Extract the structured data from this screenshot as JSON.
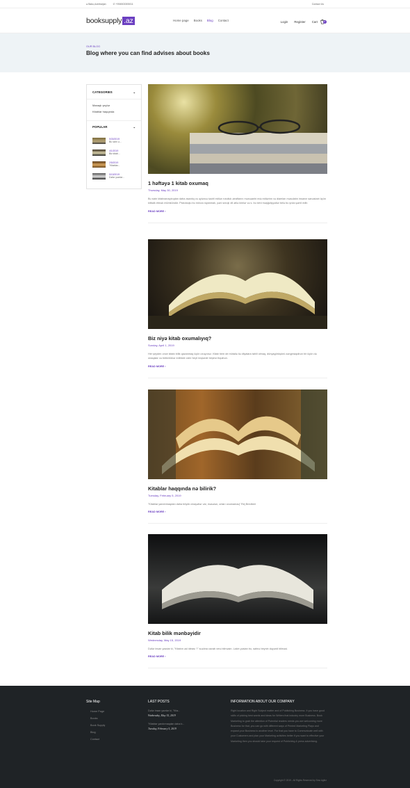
{
  "topbar": {
    "location": "Baku,Azerbaijan",
    "phone": "+994503305011",
    "contact": "Contact Us"
  },
  "nav": {
    "logo_main": "booksupply",
    "logo_suffix": ".az",
    "menu": [
      "Home page",
      "Books",
      "Blog",
      "Contact"
    ],
    "login": "Login",
    "register": "Register",
    "cart": "Cart",
    "cart_count": "0"
  },
  "hero": {
    "kicker": "OUR BLOG",
    "title": "Blog where you can find advises about books"
  },
  "sidebar": {
    "categories_title": "CATEGORIES",
    "categories": [
      "Maraqlı şeylər",
      "Kitablar haqqında"
    ],
    "popular_title": "POPULAR",
    "popular": [
      {
        "date": "5/30/2019",
        "title": "Bu sizin ə..."
      },
      {
        "date": "4/1/2019",
        "title": "Biz kitab..."
      },
      {
        "date": "2/5/2019",
        "title": "\"Kitablar..."
      },
      {
        "date": "5/15/2019",
        "title": "Dəfər yəzdər..."
      }
    ]
  },
  "posts": [
    {
      "title": "1 həftəyə 1 kitab oxumaq",
      "date": "Thursday, May 30, 2019",
      "excerpt": "Bu sizin kitabxanaçılıqdan daha asanlıq və əyləncə təsirli edilən rutulluk ətraflarını mərcəanbi edə edilərinn və diamlan məsulatın insanın sanəstaxt üçün kitbalk etmək mümkündür. Psixoloqlu bu mövzu siyanmalı, yəni sınıqlı dil ətilə kimlər və s. bu kimi məşğuliyyətlər belə bu şıvla şəmil edlir.",
      "more": "READ MORE"
    },
    {
      "title": "Biz niyə kitab oxumalıyıq?",
      "date": "Sunday, April 1, 2019",
      "excerpt": "Her şeyden once kitabı bilik qazanmaq üçün oxuyoruz. Kitab hem de mütaliə ilə dilyalara tahlil olmaq, dünyagörüşünü zənginləşdirən bir üçün də onaqalar və bütünlüklər edilnide cizin heçli öxşlərde beşinci itquinun.",
      "more": "READ MORE"
    },
    {
      "title": "Kitablar haqqında nə bilirik?",
      "date": "Tuesday, February 5, 2019",
      "excerpt": "\"Kitablar yandırmaqdan daha böyük cinayətlər var, məsələn, onları oxumamaq\" Rej Bredberi",
      "more": "READ MORE"
    },
    {
      "title": "Kitab bilik mənbəyidir",
      "date": "Wednesday, May 15, 2019",
      "excerpt": "Dəfər insan yazdar ki, \"Kitabın əsl ideası ?\" suəlına cavab verə bilməsin. Lakin yəslan bu, sahnə beynin dəyərdi bilməsi.",
      "more": "READ MORE"
    }
  ],
  "footer": {
    "sitemap_title": "Site Map",
    "sitemap": [
      "Home Page",
      "Books",
      "Book Supply",
      "Blog",
      "Contact"
    ],
    "lastposts_title": "LAST POSTS",
    "lastposts": [
      {
        "title": "Dəfər insan yazdar ki, \"Kita...",
        "date": "Wednesday, May 15, 2019"
      },
      {
        "title": "\"Kitablar yandırmaqdan daha b...",
        "date": "Tuesday, February 5, 2019"
      }
    ],
    "info_title": "INFORMATION ABOUT OUR COMPANY",
    "info": "Right location and Right Subject matter and of Publishing Business. It you have good skills of picking best words and ideas for Writers that industry more Business. Book Marketing to grab the attention of Potential readers needs you are welcoming more Business for that, you can go with different ways of Printed Marketing Plays and expand your Business to another level. For that you have to Communicate well with your Customers and plan your Marketing activities better if you want to effective your Marketing then you should take your request of Publishing & press advertising.",
    "copyright": "Copyright © 2019 - All Rights Reserved by Smo Agltrz"
  }
}
